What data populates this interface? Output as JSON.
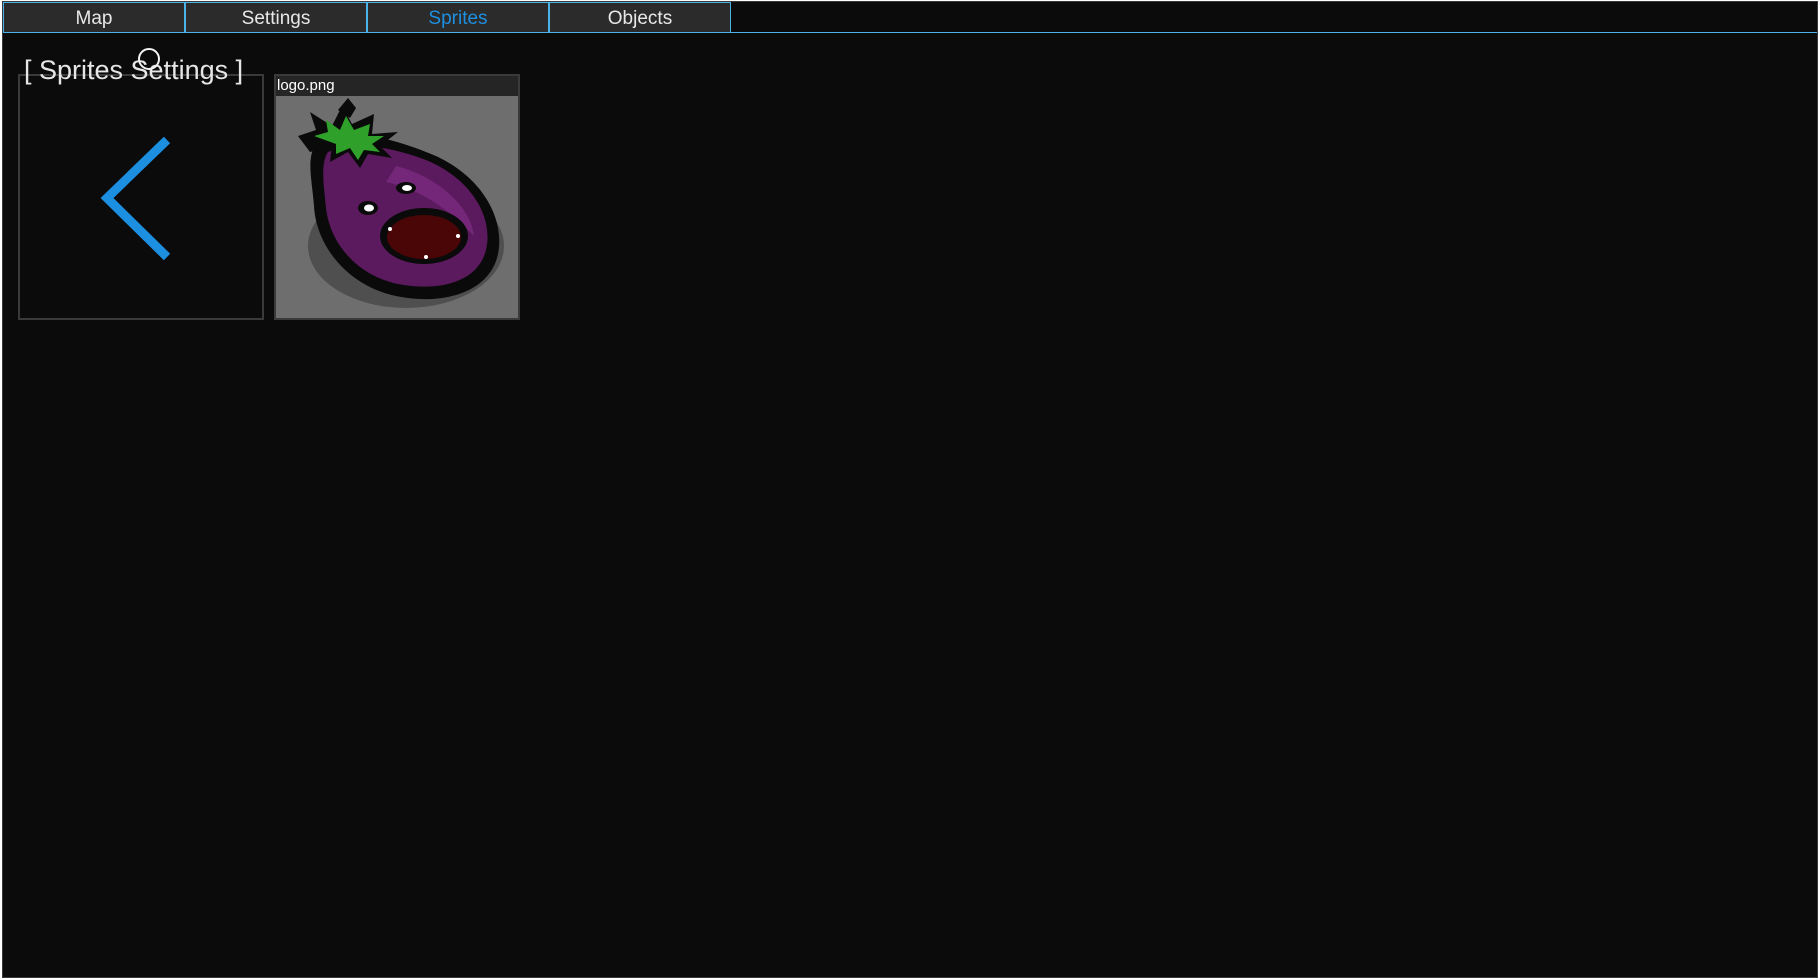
{
  "tabs": [
    {
      "label": "Map",
      "active": false
    },
    {
      "label": "Settings",
      "active": false
    },
    {
      "label": "Sprites",
      "active": true
    },
    {
      "label": "Objects",
      "active": false
    }
  ],
  "section": {
    "title": "[ Sprites Settings ]"
  },
  "tiles": {
    "back": {
      "icon": "chevron-left-icon"
    },
    "sprites": [
      {
        "filename": "logo.png",
        "thumbnail": "eggplant-mascot-image"
      }
    ]
  },
  "colors": {
    "accent": "#1d8fe0",
    "tab_border": "#4ab3e8",
    "background": "#0b0b0b",
    "tab_background": "#2b2b2b",
    "thumbnail_background": "#6e6e6e"
  }
}
